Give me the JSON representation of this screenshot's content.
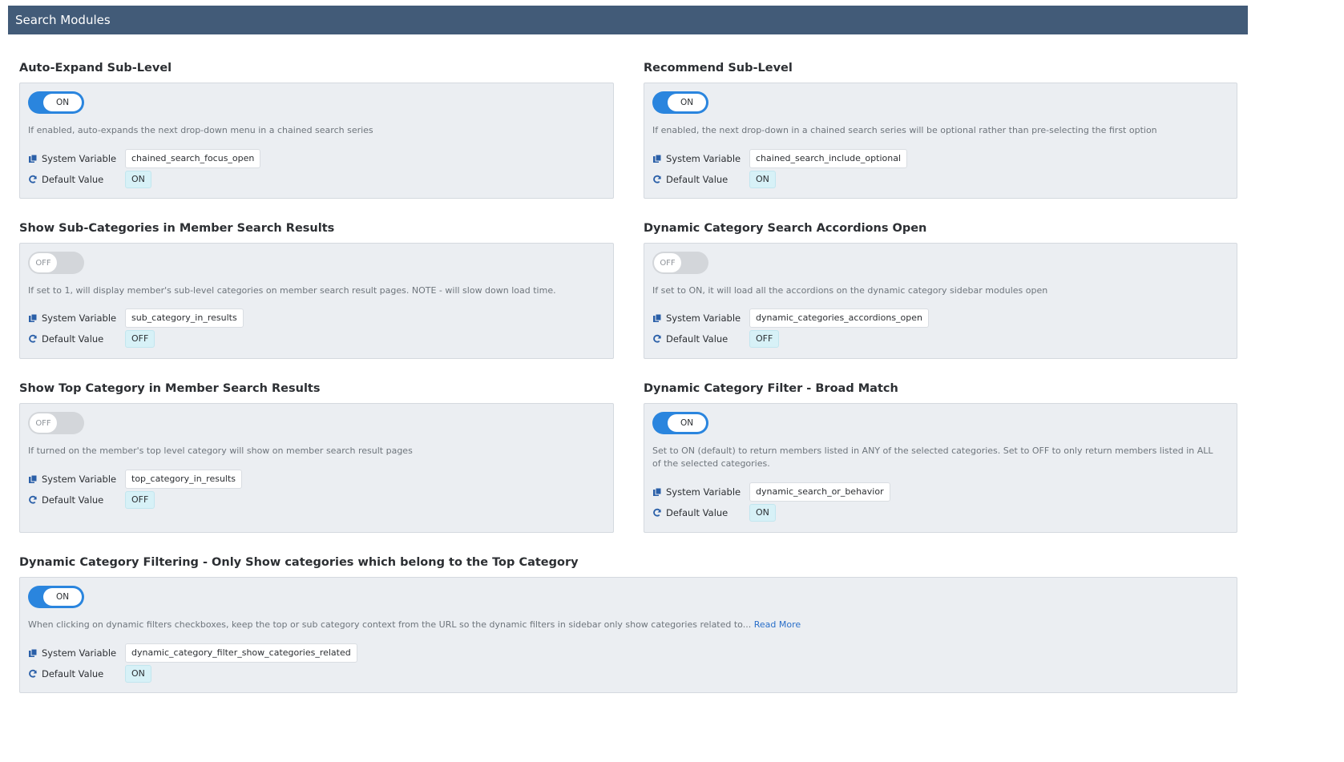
{
  "header": {
    "title": "Search Modules"
  },
  "labels": {
    "system_variable": "System Variable",
    "default_value": "Default Value"
  },
  "settings": [
    {
      "title": "Auto-Expand Sub-Level",
      "toggle": "ON",
      "description": "If enabled, auto-expands the next drop-down menu in a chained search series",
      "variable": "chained_search_focus_open",
      "default": "ON"
    },
    {
      "title": "Recommend Sub-Level",
      "toggle": "ON",
      "description": "If enabled, the next drop-down in a chained search series will be optional rather than pre-selecting the first option",
      "variable": "chained_search_include_optional",
      "default": "ON"
    },
    {
      "title": "Show Sub-Categories in Member Search Results",
      "toggle": "OFF",
      "description": "If set to 1, will display member's sub-level categories on member search result pages. NOTE - will slow down load time.",
      "variable": "sub_category_in_results",
      "default": "OFF"
    },
    {
      "title": "Dynamic Category Search Accordions Open",
      "toggle": "OFF",
      "description": "If set to ON, it will load all the accordions on the dynamic category sidebar modules open",
      "variable": "dynamic_categories_accordions_open",
      "default": "OFF"
    },
    {
      "title": "Show Top Category in Member Search Results",
      "toggle": "OFF",
      "description": "If turned on the member's top level category will show on member search result pages",
      "variable": "top_category_in_results",
      "default": "OFF"
    },
    {
      "title": "Dynamic Category Filter - Broad Match",
      "toggle": "ON",
      "description": "Set to ON (default) to return members listed in ANY of the selected categories. Set to OFF to only return members listed in ALL of the selected categories.",
      "variable": "dynamic_search_or_behavior",
      "default": "ON"
    },
    {
      "title": "Dynamic Category Filtering - Only Show categories which belong to the Top Category",
      "toggle": "ON",
      "description": "When clicking on dynamic filters checkboxes, keep the top or sub category context from the URL so the dynamic filters in sidebar only show categories related to...",
      "read_more": "Read More",
      "variable": "dynamic_category_filter_show_categories_related",
      "default": "ON"
    }
  ],
  "colors": {
    "header_bg": "#425b78",
    "toggle_on": "#2a85de",
    "toggle_off": "#d3d6da",
    "link": "#2a6fc9"
  }
}
